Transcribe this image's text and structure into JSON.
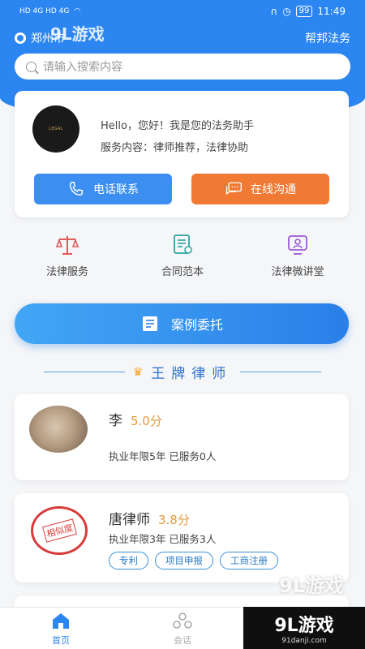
{
  "status_bar": {
    "left": "HD 4G HD 4G",
    "battery": "99",
    "time": "11:49"
  },
  "header": {
    "location": "郑州市",
    "app_name": "帮邦法务"
  },
  "search": {
    "placeholder": "请输入搜索内容"
  },
  "assistant": {
    "logo_text": "LEGAL",
    "greeting": "Hello，您好！我是您的法务助手",
    "service": "服务内容：律师推荐，法律协助",
    "call_label": "电话联系",
    "chat_label": "在线沟通"
  },
  "quick_links": [
    {
      "label": "法律服务",
      "icon": "scale-icon"
    },
    {
      "label": "合同范本",
      "icon": "contract-icon"
    },
    {
      "label": "法律微讲堂",
      "icon": "lecture-icon"
    }
  ],
  "case_button": "案例委托",
  "section_title": "王牌律师",
  "lawyers": [
    {
      "name": "李",
      "score": "5.0分",
      "info": "执业年限5年 已服务0人",
      "tags": []
    },
    {
      "name": "唐律师",
      "score": "3.8分",
      "info": "执业年限3年 已服务3人",
      "tags": [
        "专利",
        "项目申报",
        "工商注册"
      ],
      "stamp": "相似度"
    }
  ],
  "tabs": [
    {
      "label": "首页"
    },
    {
      "label": "会话"
    }
  ],
  "watermark": {
    "main": "9L游戏",
    "sub": "91danji.com"
  },
  "colors": {
    "primary": "#2c86f1",
    "orange": "#f07a34",
    "score": "#e39a3c"
  }
}
